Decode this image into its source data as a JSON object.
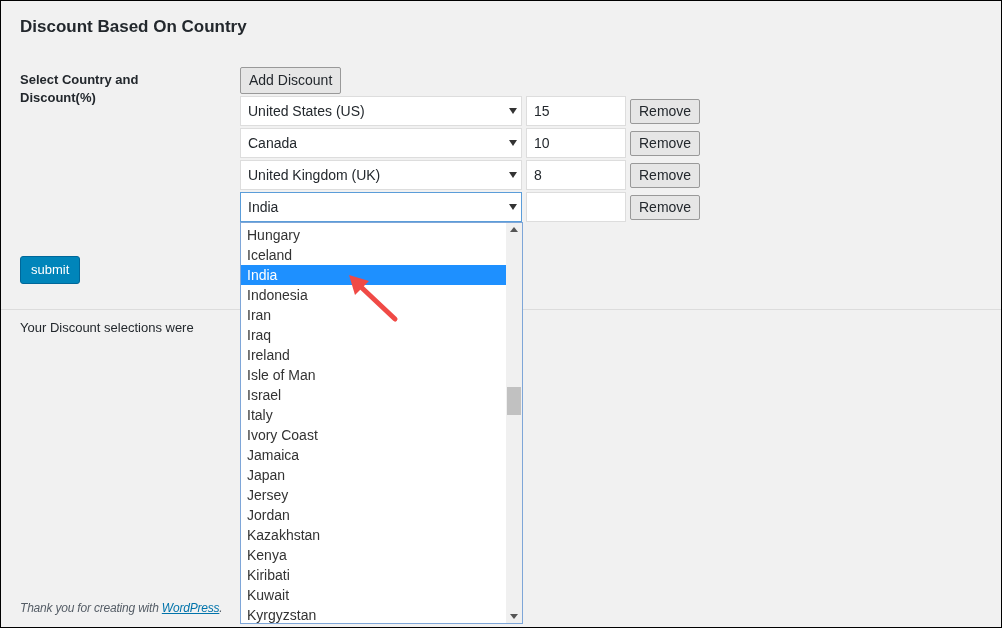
{
  "title": "Discount Based On Country",
  "field_label": "Select Country and Discount(%)",
  "add_button": "Add Discount",
  "rows": [
    {
      "country": "United States (US)",
      "discount": "15",
      "remove": "Remove",
      "focused": false
    },
    {
      "country": "Canada",
      "discount": "10",
      "remove": "Remove",
      "focused": false
    },
    {
      "country": "United Kingdom (UK)",
      "discount": "8",
      "remove": "Remove",
      "focused": false
    },
    {
      "country": "India",
      "discount": "",
      "remove": "Remove",
      "focused": true,
      "dropdown": [
        {
          "label": "Hungary",
          "selected": false
        },
        {
          "label": "Iceland",
          "selected": false
        },
        {
          "label": "India",
          "selected": true
        },
        {
          "label": "Indonesia",
          "selected": false
        },
        {
          "label": "Iran",
          "selected": false
        },
        {
          "label": "Iraq",
          "selected": false
        },
        {
          "label": "Ireland",
          "selected": false
        },
        {
          "label": "Isle of Man",
          "selected": false
        },
        {
          "label": "Israel",
          "selected": false
        },
        {
          "label": "Italy",
          "selected": false
        },
        {
          "label": "Ivory Coast",
          "selected": false
        },
        {
          "label": "Jamaica",
          "selected": false
        },
        {
          "label": "Japan",
          "selected": false
        },
        {
          "label": "Jersey",
          "selected": false
        },
        {
          "label": "Jordan",
          "selected": false
        },
        {
          "label": "Kazakhstan",
          "selected": false
        },
        {
          "label": "Kenya",
          "selected": false
        },
        {
          "label": "Kiribati",
          "selected": false
        },
        {
          "label": "Kuwait",
          "selected": false
        },
        {
          "label": "Kyrgyzstan",
          "selected": false
        }
      ]
    }
  ],
  "submit": "submit",
  "result_text": "Your Discount selections were",
  "footer": {
    "text": "Thank you for creating with ",
    "link": "WordPress",
    "end": "."
  }
}
